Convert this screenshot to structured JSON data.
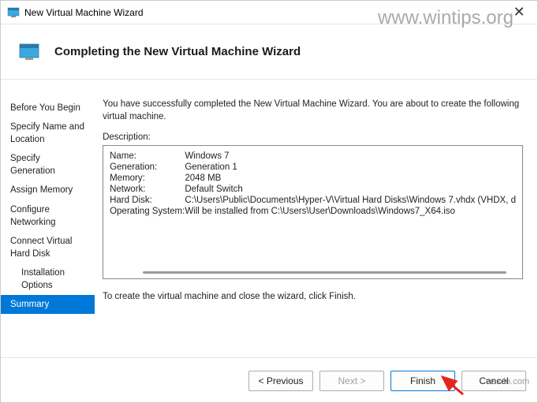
{
  "watermarks": {
    "top": "www.wintips.org",
    "bottom": "wsxdn.com"
  },
  "window": {
    "title": "New Virtual Machine Wizard"
  },
  "header": {
    "heading": "Completing the New Virtual Machine Wizard"
  },
  "sidebar": {
    "items": [
      "Before You Begin",
      "Specify Name and Location",
      "Specify Generation",
      "Assign Memory",
      "Configure Networking",
      "Connect Virtual Hard Disk",
      "Installation Options",
      "Summary"
    ]
  },
  "main": {
    "intro": "You have successfully completed the New Virtual Machine Wizard. You are about to create the following virtual machine.",
    "description_label": "Description:",
    "fields": {
      "name_label": "Name:",
      "name_value": "Windows 7",
      "generation_label": "Generation:",
      "generation_value": "Generation 1",
      "memory_label": "Memory:",
      "memory_value": "2048 MB",
      "network_label": "Network:",
      "network_value": "Default Switch",
      "harddisk_label": "Hard Disk:",
      "harddisk_value": "C:\\Users\\Public\\Documents\\Hyper-V\\Virtual Hard Disks\\Windows 7.vhdx (VHDX, d",
      "os_label": "Operating System:",
      "os_value": "Will be installed from C:\\Users\\User\\Downloads\\Windows7_X64.iso"
    },
    "footer": "To create the virtual machine and close the wizard, click Finish."
  },
  "buttons": {
    "previous": "< Previous",
    "next": "Next >",
    "finish": "Finish",
    "cancel": "Cancel"
  }
}
